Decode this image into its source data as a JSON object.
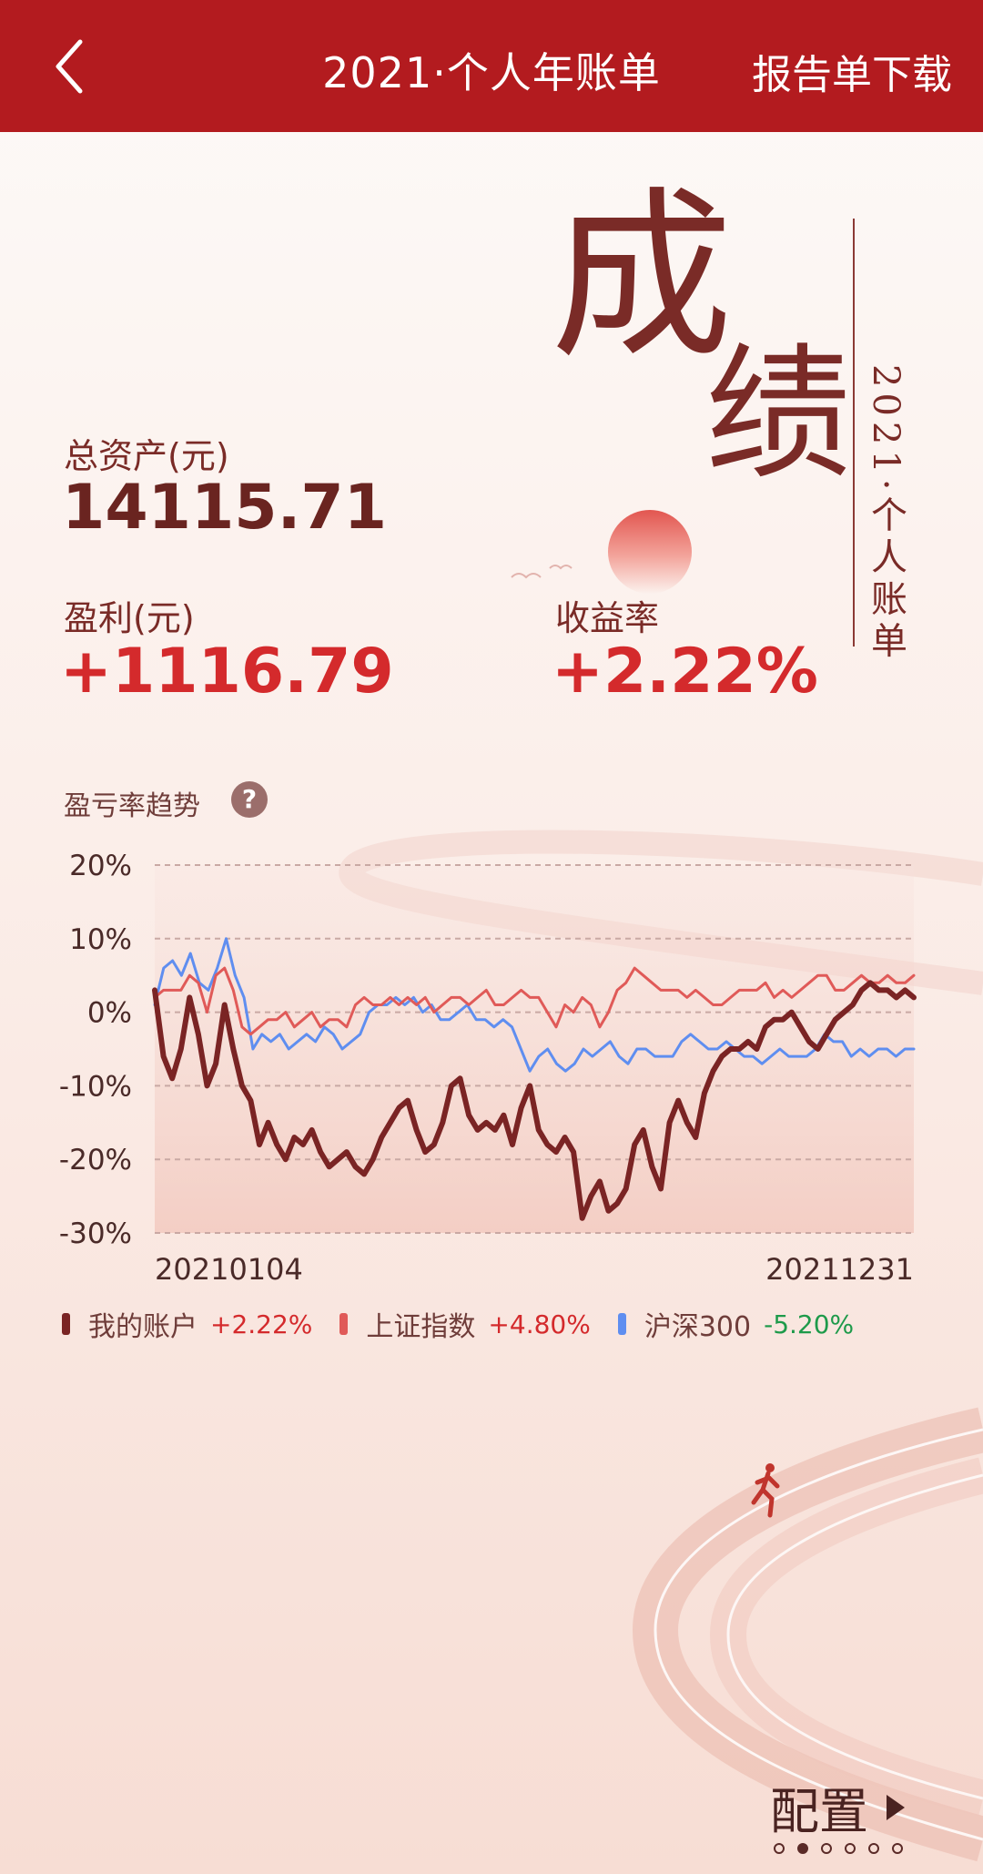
{
  "header": {
    "title": "2021·个人年账单",
    "download_label": "报告单下载"
  },
  "hero": {
    "char1": "成",
    "char2": "绩",
    "subtitle": "2021·个人账单"
  },
  "summary": {
    "total_assets_label": "总资产(元)",
    "total_assets_value": "14115.71",
    "profit_label": "盈利(元)",
    "profit_value": "+1116.79",
    "return_label": "收益率",
    "return_value": "+2.22%"
  },
  "trend": {
    "label": "盈亏率趋势",
    "help": "?"
  },
  "chart_data": {
    "type": "line",
    "ylim": [
      -30,
      20
    ],
    "yticks": [
      "20%",
      "10%",
      "0%",
      "-10%",
      "-20%",
      "-30%"
    ],
    "x_start_label": "20210104",
    "x_end_label": "20211231",
    "series": [
      {
        "name": "我的账户",
        "color": "#7a2424",
        "values": [
          3,
          -6,
          -9,
          -5,
          2,
          -3,
          -10,
          -7,
          1,
          -5,
          -10,
          -12,
          -18,
          -15,
          -18,
          -20,
          -17,
          -18,
          -16,
          -19,
          -21,
          -20,
          -19,
          -21,
          -22,
          -20,
          -17,
          -15,
          -13,
          -12,
          -16,
          -19,
          -18,
          -15,
          -10,
          -9,
          -14,
          -16,
          -15,
          -16,
          -14,
          -18,
          -13,
          -10,
          -16,
          -18,
          -19,
          -17,
          -19,
          -28,
          -25,
          -23,
          -27,
          -26,
          -24,
          -18,
          -16,
          -21,
          -24,
          -15,
          -12,
          -15,
          -17,
          -11,
          -8,
          -6,
          -5,
          -5,
          -4,
          -5,
          -2,
          -1,
          -1,
          0,
          -2,
          -4,
          -5,
          -3,
          -1,
          0,
          1,
          3,
          4,
          3,
          3,
          2,
          3,
          2
        ]
      },
      {
        "name": "上证指数",
        "color": "#e05a58",
        "values": [
          2,
          3,
          3,
          3,
          5,
          4,
          0,
          5,
          6,
          3,
          -2,
          -3,
          -2,
          -1,
          -1,
          0,
          -2,
          -1,
          0,
          -2,
          -1,
          -1,
          -2,
          1,
          2,
          1,
          1,
          2,
          1,
          2,
          1,
          2,
          0,
          1,
          2,
          2,
          1,
          2,
          3,
          1,
          1,
          2,
          3,
          2,
          2,
          0,
          -2,
          1,
          0,
          2,
          1,
          -2,
          0,
          3,
          4,
          6,
          5,
          4,
          3,
          3,
          3,
          2,
          3,
          2,
          1,
          1,
          2,
          3,
          3,
          3,
          4,
          2,
          3,
          2,
          3,
          4,
          5,
          5,
          3,
          3,
          4,
          5,
          4,
          4,
          5,
          4,
          4,
          5
        ]
      },
      {
        "name": "沪深300",
        "color": "#5f8ef0",
        "values": [
          1,
          6,
          7,
          5,
          8,
          4,
          3,
          6,
          10,
          5,
          2,
          -5,
          -3,
          -4,
          -3,
          -5,
          -4,
          -3,
          -4,
          -2,
          -3,
          -5,
          -4,
          -3,
          0,
          1,
          1,
          2,
          1,
          2,
          0,
          1,
          -1,
          -1,
          0,
          1,
          -1,
          -1,
          -2,
          -1,
          -2,
          -5,
          -8,
          -6,
          -5,
          -7,
          -8,
          -7,
          -5,
          -6,
          -5,
          -4,
          -6,
          -7,
          -5,
          -5,
          -6,
          -6,
          -6,
          -4,
          -3,
          -4,
          -5,
          -5,
          -4,
          -5,
          -6,
          -6,
          -7,
          -6,
          -5,
          -6,
          -6,
          -6,
          -5,
          -3,
          -4,
          -4,
          -6,
          -5,
          -6,
          -5,
          -5,
          -6,
          -5,
          -5
        ]
      }
    ]
  },
  "legend": [
    {
      "name": "我的账户",
      "value": "+2.22%",
      "color": "#7a2424",
      "tone": "red"
    },
    {
      "name": "上证指数",
      "value": "+4.80%",
      "color": "#e05a58",
      "tone": "red"
    },
    {
      "name": "沪深300",
      "value": "-5.20%",
      "color": "#5f8ef0",
      "tone": "green"
    }
  ],
  "next": {
    "label": "配置"
  },
  "pager": {
    "count": 6,
    "active": 1
  }
}
